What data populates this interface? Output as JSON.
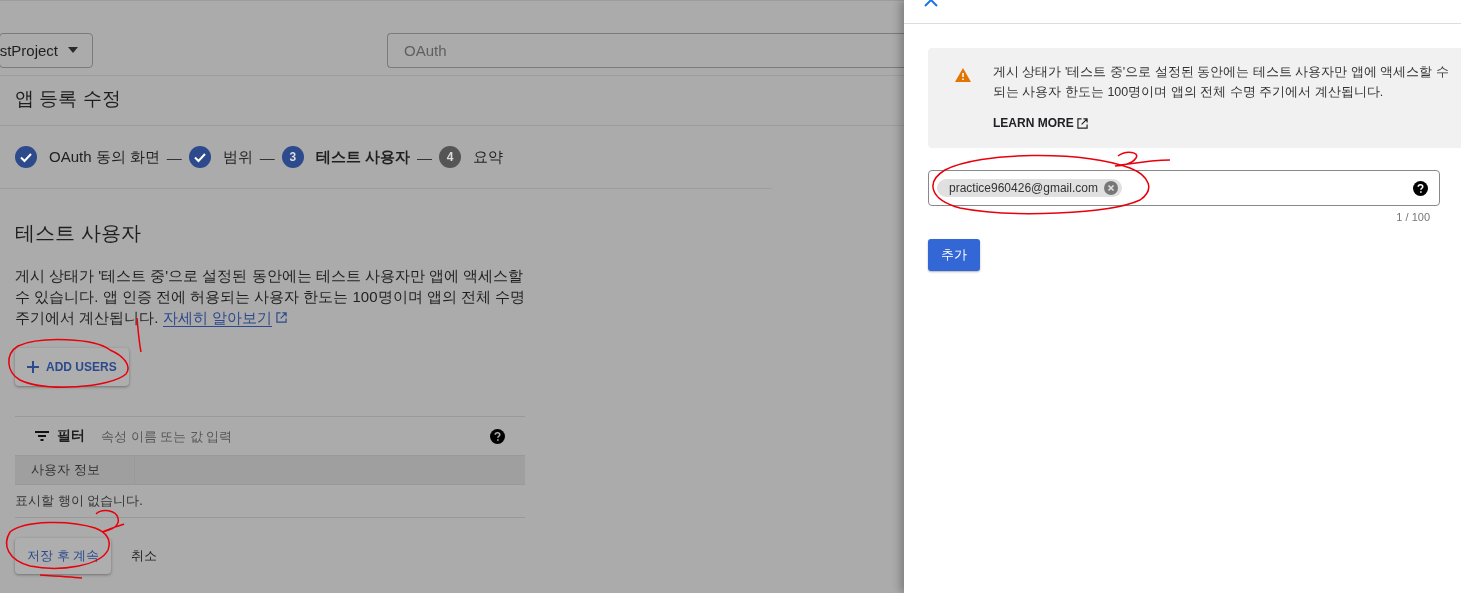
{
  "project_selector": {
    "label": "stProject"
  },
  "search": {
    "placeholder": "OAuth"
  },
  "page_title": "앱 등록 수정",
  "steps": [
    {
      "kind": "done",
      "label": "OAuth 동의 화면",
      "selected": false
    },
    {
      "kind": "done",
      "label": "범위",
      "selected": false
    },
    {
      "kind": "current",
      "number": "3",
      "label": "테스트 사용자",
      "selected": true
    },
    {
      "kind": "upcoming",
      "number": "4",
      "label": "요약",
      "selected": false
    }
  ],
  "step_separator": "—",
  "section": {
    "title": "테스트 사용자",
    "description": "게시 상태가 '테스트 중'으로 설정된 동안에는 테스트 사용자만 앱에 액세스할 수 있습니다. 앱 인증 전에 허용되는 사용자 한도는 100명이며 앱의 전체 수명 주기에서 계산됩니다.",
    "link": "자세히 알아보기"
  },
  "add_users_button": "ADD USERS",
  "filter": {
    "label": "필터",
    "placeholder": "속성 이름 또는 값 입력"
  },
  "table": {
    "columns": [
      "사용자 정보"
    ],
    "empty_message": "표시할 행이 없습니다."
  },
  "actions": {
    "save": "저장 후 계속",
    "cancel": "취소"
  },
  "panel": {
    "notice": {
      "lines": [
        "게시 상태가 '테스트 중'으로 설정된 동안에는 테스트 사용자만 앱에 액세스할 수",
        "되는 사용자 한도는 100명이며 앱의 전체 수명 주기에서 계산됩니다."
      ],
      "link": "LEARN MORE"
    },
    "chips": [
      {
        "label": "practice960426@gmail.com"
      }
    ],
    "counter": "1 / 100",
    "add_button": "추가"
  }
}
